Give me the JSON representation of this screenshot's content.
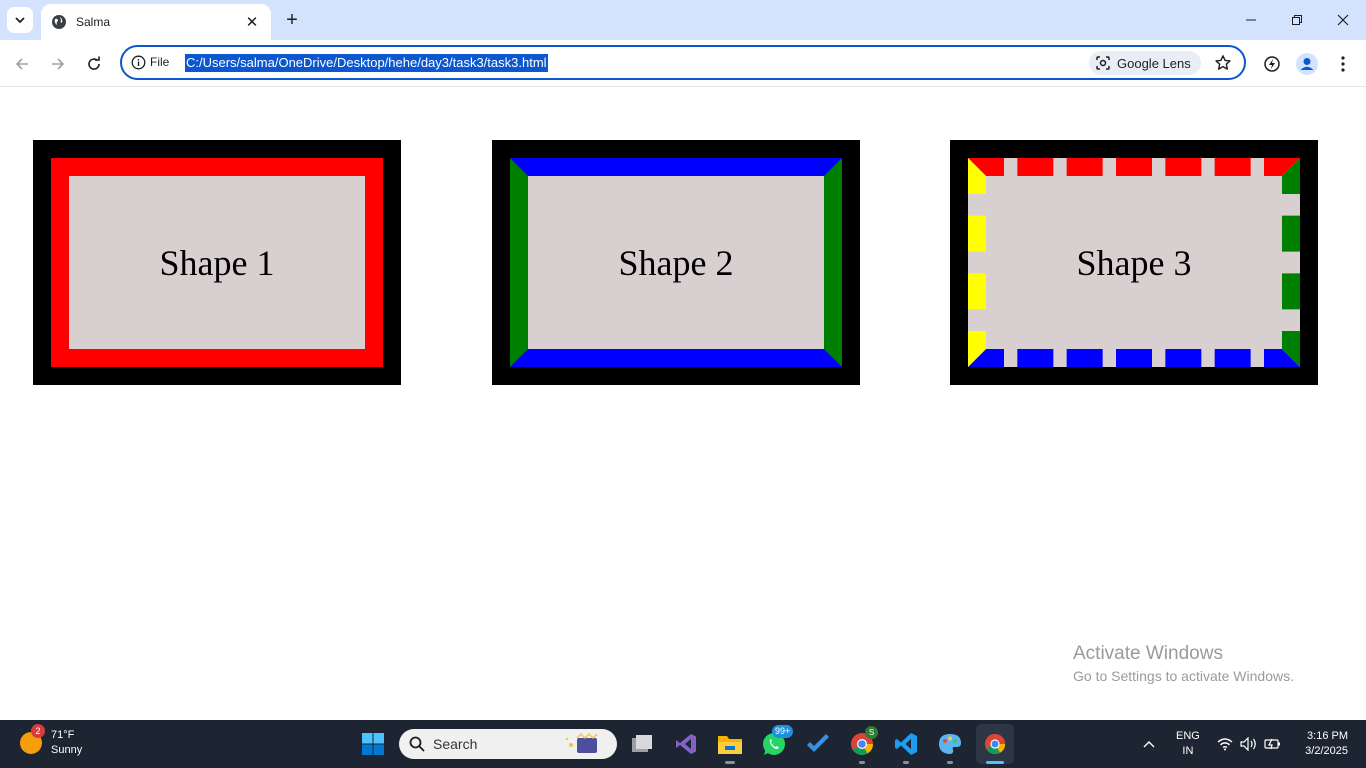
{
  "browser": {
    "tab_title": "Salma",
    "url_scheme_label": "File",
    "url": "C:/Users/salma/OneDrive/Desktop/hehe/day3/task3/task3.html",
    "lens_label": "Google Lens"
  },
  "page": {
    "shapes": [
      {
        "label": "Shape 1",
        "border": "solid",
        "colors": [
          "#ff0000"
        ]
      },
      {
        "label": "Shape 2",
        "border": "solid",
        "colors": [
          "#0000ff",
          "#008000"
        ]
      },
      {
        "label": "Shape 3",
        "border": "dashed",
        "colors": [
          "#ff0000",
          "#008000",
          "#0000ff",
          "#ffff00"
        ]
      }
    ],
    "watermark": {
      "title": "Activate Windows",
      "subtitle": "Go to Settings to activate Windows."
    }
  },
  "taskbar": {
    "weather": {
      "temp": "71°F",
      "condition": "Sunny",
      "badge": "2"
    },
    "search_placeholder": "Search",
    "whatsapp_badge": "99+",
    "chrome_badge": "S",
    "lang_line1": "ENG",
    "lang_line2": "IN",
    "time": "3:16 PM",
    "date": "3/2/2025"
  },
  "icons": [
    "tab-search-icon",
    "globe-icon",
    "close-icon",
    "plus-icon",
    "minimize-icon",
    "restore-icon",
    "window-close-icon",
    "back-icon",
    "forward-icon",
    "reload-icon",
    "info-icon",
    "lens-icon",
    "star-icon",
    "performance-icon",
    "profile-icon",
    "menu-icon",
    "windows-start-icon",
    "search-icon",
    "task-view-icon",
    "visual-studio-icon",
    "file-explorer-icon",
    "whatsapp-icon",
    "todo-icon",
    "chrome-icon",
    "vscode-icon",
    "paint-icon",
    "chevron-up-icon",
    "wifi-icon",
    "volume-icon",
    "battery-icon"
  ],
  "colors": {
    "accent": "#0b57d0",
    "tabstrip": "#d3e3fd",
    "taskbar": "#1c2531"
  }
}
